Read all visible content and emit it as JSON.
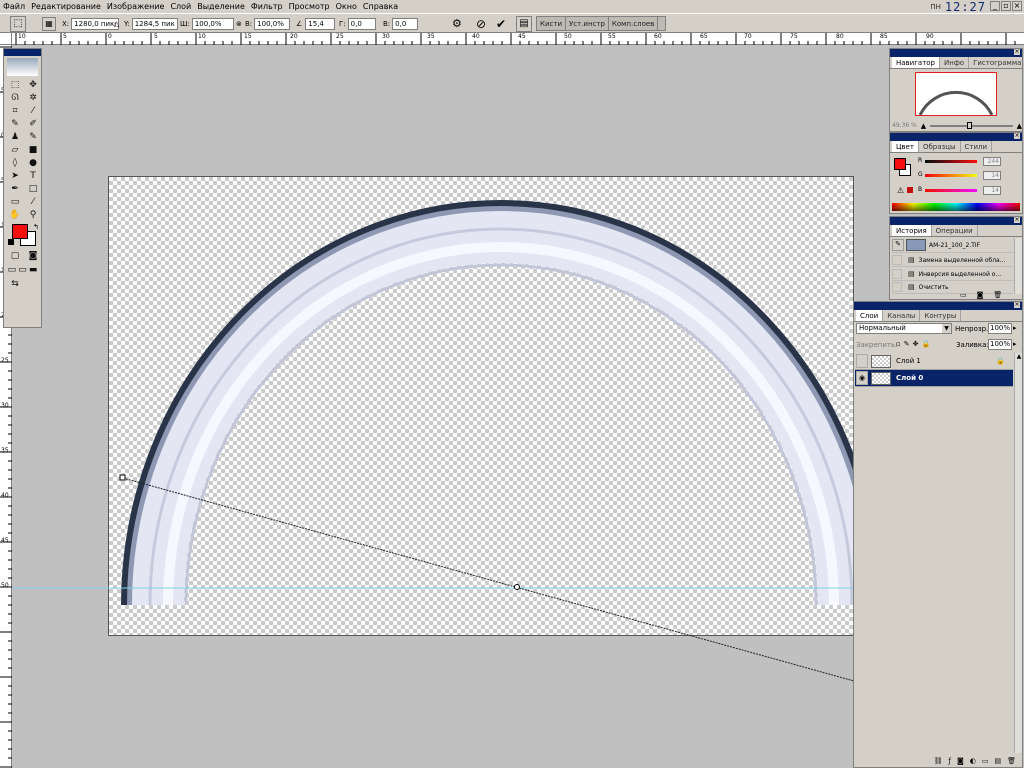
{
  "menubar": {
    "items": [
      "Файл",
      "Редактирование",
      "Изображение",
      "Слой",
      "Выделение",
      "Фильтр",
      "Просмотр",
      "Окно",
      "Справка"
    ],
    "clock_label": "ПН",
    "clock_time": "12:27"
  },
  "options": {
    "x_label": "X:",
    "x_value": "1280,0 пикс",
    "y_label": "Y:",
    "y_value": "1284,5 пикс",
    "w_label": "Ш:",
    "w_value": "100,0%",
    "h_label": "В:",
    "h_value": "100,0%",
    "angle_value": "15,4",
    "hskew_label": "Г:",
    "hskew_value": "0,0",
    "vskew_label": "В:",
    "vskew_value": "0,0",
    "palette_tabs": [
      "Кисти",
      "Уст.инстр",
      "Комп.слоев"
    ]
  },
  "rulers": {
    "h_labels": [
      "10",
      "5",
      "0",
      "5",
      "10",
      "15",
      "20",
      "25",
      "30",
      "35",
      "40",
      "45",
      "50",
      "55",
      "60",
      "65",
      "70",
      "75",
      "80",
      "85",
      "90"
    ],
    "v_labels": [
      "5",
      "0",
      "5",
      "10",
      "15",
      "20",
      "25",
      "30",
      "35",
      "40",
      "45",
      "50"
    ]
  },
  "navigator": {
    "tabs": [
      "Навигатор",
      "Инфо",
      "Гистограмма"
    ],
    "zoom": "49,36 %"
  },
  "color_panel": {
    "tabs": [
      "Цвет",
      "Образцы",
      "Стили"
    ],
    "channels": [
      {
        "label": "R",
        "value": "244"
      },
      {
        "label": "G",
        "value": "14"
      },
      {
        "label": "B",
        "value": "14"
      }
    ],
    "foreground": "#f40e0e",
    "background": "#ffffff"
  },
  "history": {
    "tabs": [
      "История",
      "Операции"
    ],
    "snapshot": "AM-21_100_2.TIF",
    "items": [
      "Замена выделенной обла...",
      "Инверсия выделенной о...",
      "Очистить"
    ]
  },
  "layers": {
    "tabs": [
      "Слои",
      "Каналы",
      "Контуры"
    ],
    "blend_mode": "Нормальный",
    "opacity_label": "Непрозр.:",
    "opacity_value": "100%",
    "lock_label": "Закрепить:",
    "fill_label": "Заливка:",
    "fill_value": "100%",
    "items": [
      {
        "name": "Слой 1",
        "selected": false
      },
      {
        "name": "Слой 0",
        "selected": true
      }
    ]
  }
}
